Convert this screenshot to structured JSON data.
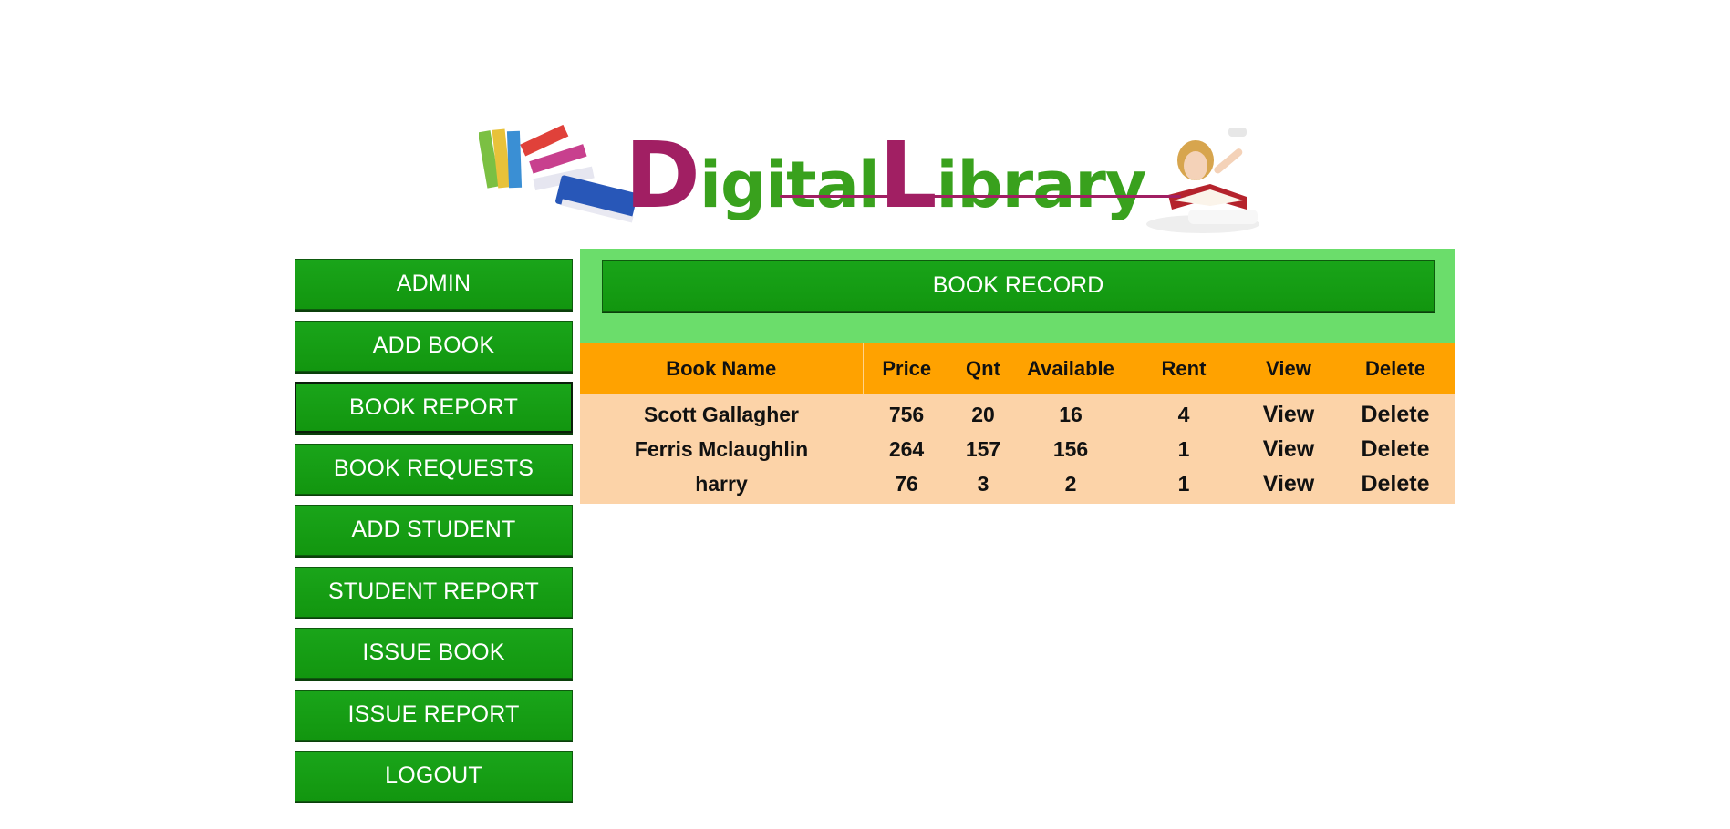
{
  "logo": {
    "big_d": "D",
    "rest_1": "igital",
    "big_l": "L",
    "rest_2": "ibrary"
  },
  "sidebar": {
    "items": [
      {
        "label": "ADMIN"
      },
      {
        "label": "ADD BOOK"
      },
      {
        "label": "BOOK REPORT"
      },
      {
        "label": "BOOK REQUESTS"
      },
      {
        "label": "ADD STUDENT"
      },
      {
        "label": "STUDENT REPORT"
      },
      {
        "label": "ISSUE BOOK"
      },
      {
        "label": "ISSUE REPORT"
      },
      {
        "label": "LOGOUT"
      }
    ]
  },
  "main": {
    "title": "BOOK RECORD",
    "columns": [
      "Book Name",
      "Price",
      "Qnt",
      "Available",
      "Rent",
      "View",
      "Delete"
    ],
    "rows": [
      {
        "name": "Scott Gallagher",
        "price": "756",
        "qnt": "20",
        "available": "16",
        "rent": "4",
        "view": "View",
        "delete": "Delete"
      },
      {
        "name": "Ferris Mclaughlin",
        "price": "264",
        "qnt": "157",
        "available": "156",
        "rent": "1",
        "view": "View",
        "delete": "Delete"
      },
      {
        "name": "harry",
        "price": "76",
        "qnt": "3",
        "available": "2",
        "rent": "1",
        "view": "View",
        "delete": "Delete"
      }
    ]
  },
  "colors": {
    "button_green": "#12960f",
    "header_green": "#6bdd6b",
    "table_header": "#ffa200",
    "table_row": "#fcd3a8",
    "logo_magenta": "#a11f63",
    "logo_green": "#39a11d"
  }
}
